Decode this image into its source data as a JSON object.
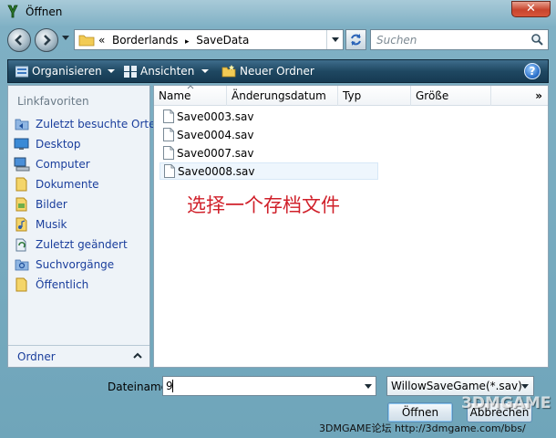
{
  "window": {
    "title": "Öffnen",
    "close_label": "✕"
  },
  "address": {
    "prefix": "«",
    "path": [
      "Borderlands",
      "SaveData"
    ],
    "separator": "▸"
  },
  "search": {
    "placeholder": "Suchen"
  },
  "toolbar": {
    "organize": "Organisieren",
    "views": "Ansichten",
    "new_folder": "Neuer Ordner",
    "help": "?"
  },
  "sidebar": {
    "header": "Linkfavoriten",
    "items": [
      {
        "label": "Zuletzt besuchte Orte",
        "icon": "recent-places-icon"
      },
      {
        "label": "Desktop",
        "icon": "desktop-icon"
      },
      {
        "label": "Computer",
        "icon": "computer-icon"
      },
      {
        "label": "Dokumente",
        "icon": "documents-icon"
      },
      {
        "label": "Bilder",
        "icon": "pictures-icon"
      },
      {
        "label": "Musik",
        "icon": "music-icon"
      },
      {
        "label": "Zuletzt geändert",
        "icon": "recently-changed-icon"
      },
      {
        "label": "Suchvorgänge",
        "icon": "searches-icon"
      },
      {
        "label": "Öffentlich",
        "icon": "public-icon"
      }
    ],
    "footer": "Ordner"
  },
  "columns": [
    "Name",
    "Änderungsdatum",
    "Typ",
    "Größe"
  ],
  "more_columns": "»",
  "files": [
    "Save0003.sav",
    "Save0004.sav",
    "Save0007.sav",
    "Save0008.sav"
  ],
  "annotation": "选择一个存档文件",
  "footer": {
    "filename_label": "Dateiname:",
    "filename_value": "9",
    "filetype": "WillowSaveGame(*.sav)",
    "open_button": "Öffnen",
    "cancel_button": "Abbrechen"
  },
  "watermark": {
    "text": "3DMGAME论坛 http://3dmgame.com/bbs/",
    "logo": "3DMGAME"
  }
}
